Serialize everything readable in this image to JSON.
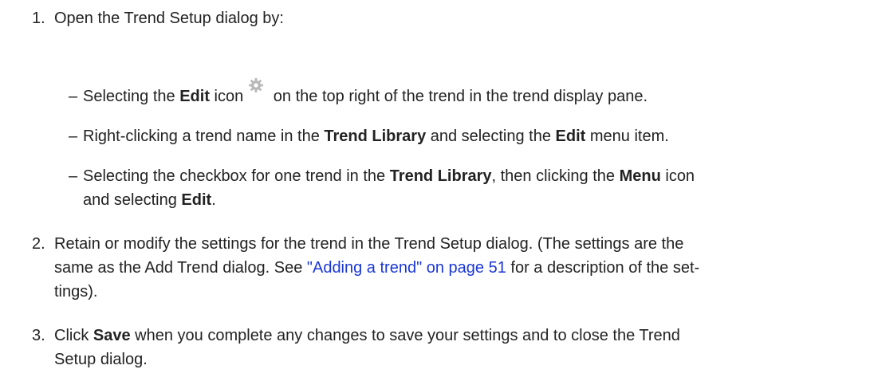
{
  "steps": [
    {
      "number": "1.",
      "text": "Open the Trend Setup dialog by:",
      "sub_items": [
        {
          "dash": "–",
          "t1": "Selecting the ",
          "b1": "Edit",
          "t2": " icon",
          "icon": "gear-icon",
          "t3": " on the top right of the trend in the trend display pane."
        },
        {
          "dash": "–",
          "t1": "Right-clicking a trend name in the ",
          "b1": "Trend Library",
          "t2": " and selecting the ",
          "b2": "Edit",
          "t3": " menu item."
        },
        {
          "dash": "–",
          "t1": "Selecting the checkbox for one trend in the ",
          "b1": "Trend Library",
          "t2": ", then clicking the ",
          "b2": "Menu",
          "t3": " icon",
          "t4": "and selecting ",
          "b3": "Edit",
          "t5": "."
        }
      ]
    },
    {
      "number": "2.",
      "line1": "Retain or modify the settings for the trend in the Trend Setup dialog. (The settings are the",
      "line2_a": "same as the Add Trend dialog. See ",
      "line2_link": "\"Adding a trend\" on page 51",
      "line2_b": " for a description of the set-",
      "line3": "tings)."
    },
    {
      "number": "3.",
      "t1": "Click ",
      "b1": "Save",
      "t2": " when you complete any changes to save your settings and to close the Trend",
      "line2": "Setup dialog."
    }
  ],
  "colors": {
    "link": "#1a37d6",
    "text": "#222222",
    "icon": "#b8b8b8"
  }
}
